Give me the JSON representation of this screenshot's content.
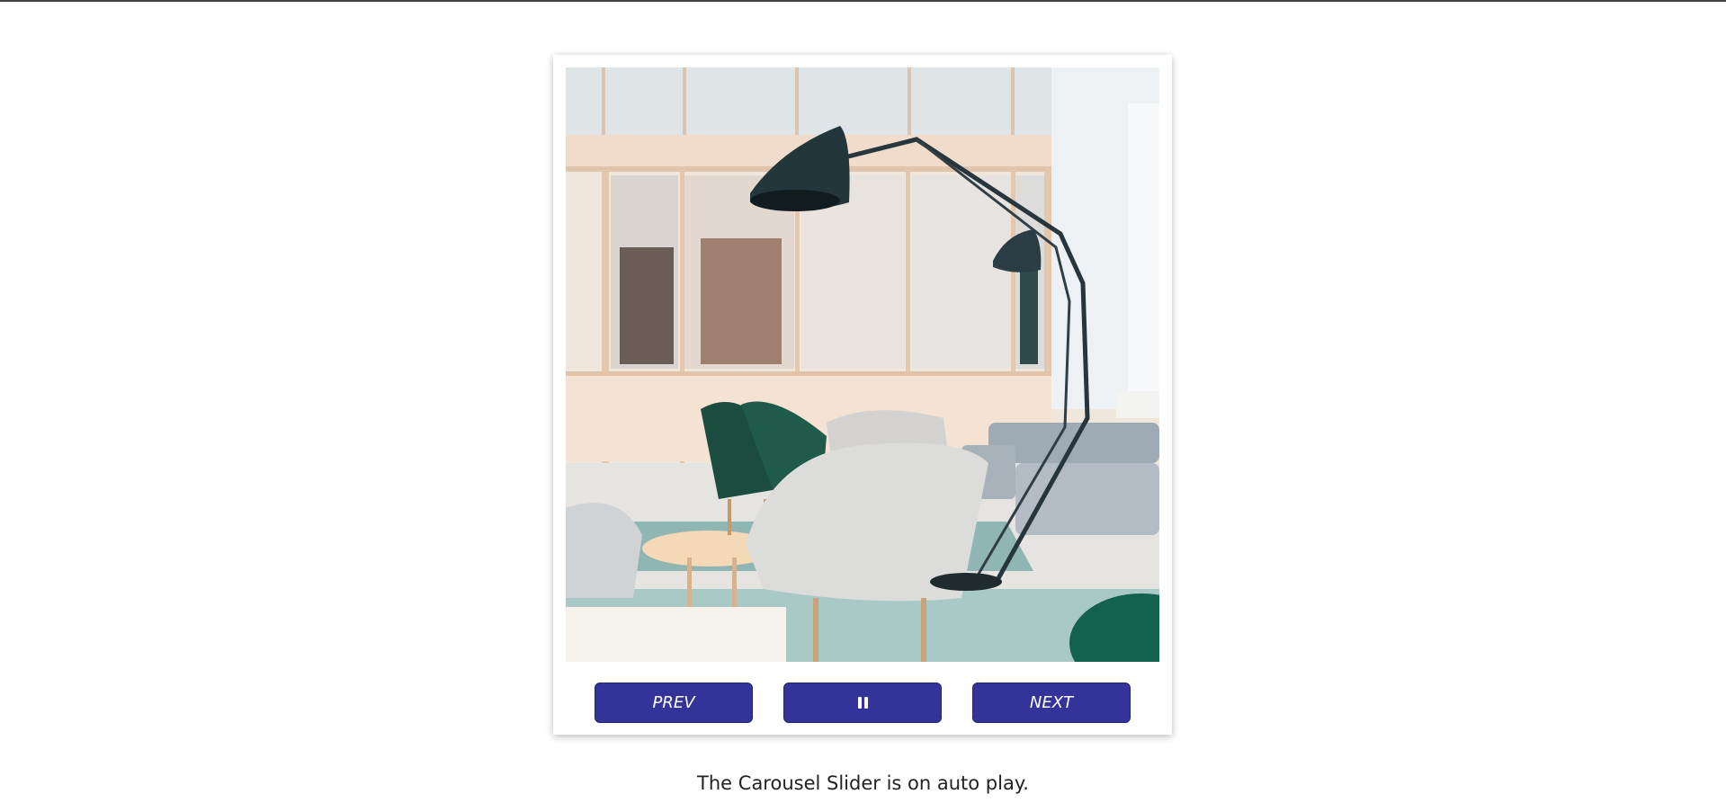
{
  "carousel": {
    "slide_image": "office-lounge-photo",
    "controls": {
      "prev_label": "PREV",
      "pause_icon": "pause-icon",
      "next_label": "NEXT"
    },
    "accent_color": "#333399"
  },
  "status_text": "The Carousel Slider is on auto play."
}
